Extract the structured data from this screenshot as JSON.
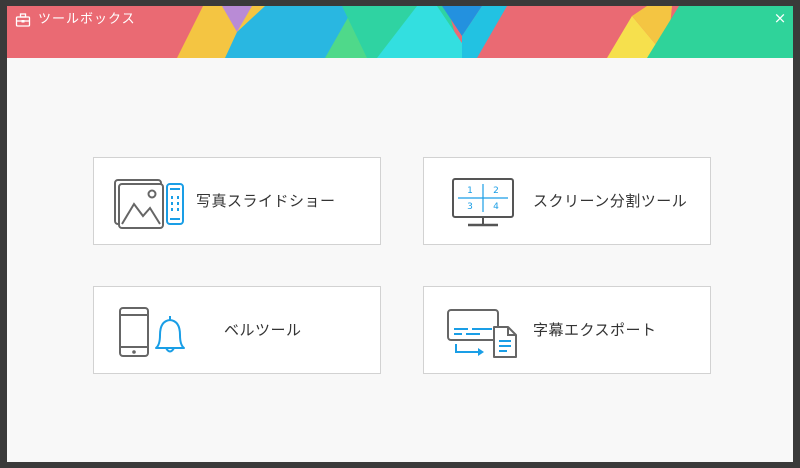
{
  "window": {
    "title": "ツールボックス",
    "close_glyph": "×"
  },
  "tools": [
    {
      "id": "slideshow",
      "label": "写真スライドショー",
      "icon": "photo-slideshow-icon"
    },
    {
      "id": "split_screen",
      "label": "スクリーン分割ツール",
      "icon": "split-screen-icon"
    },
    {
      "id": "bell",
      "label": "ベルツール",
      "icon": "phone-bell-icon"
    },
    {
      "id": "subtitle_export",
      "label": "字幕エクスポート",
      "icon": "subtitle-export-icon"
    }
  ],
  "split_screen_icon_numbers": [
    "1",
    "2",
    "3",
    "4"
  ],
  "colors": {
    "titlebar": "#ea6a73",
    "accent": "#1a9ee6",
    "icon_gray": "#666666"
  }
}
